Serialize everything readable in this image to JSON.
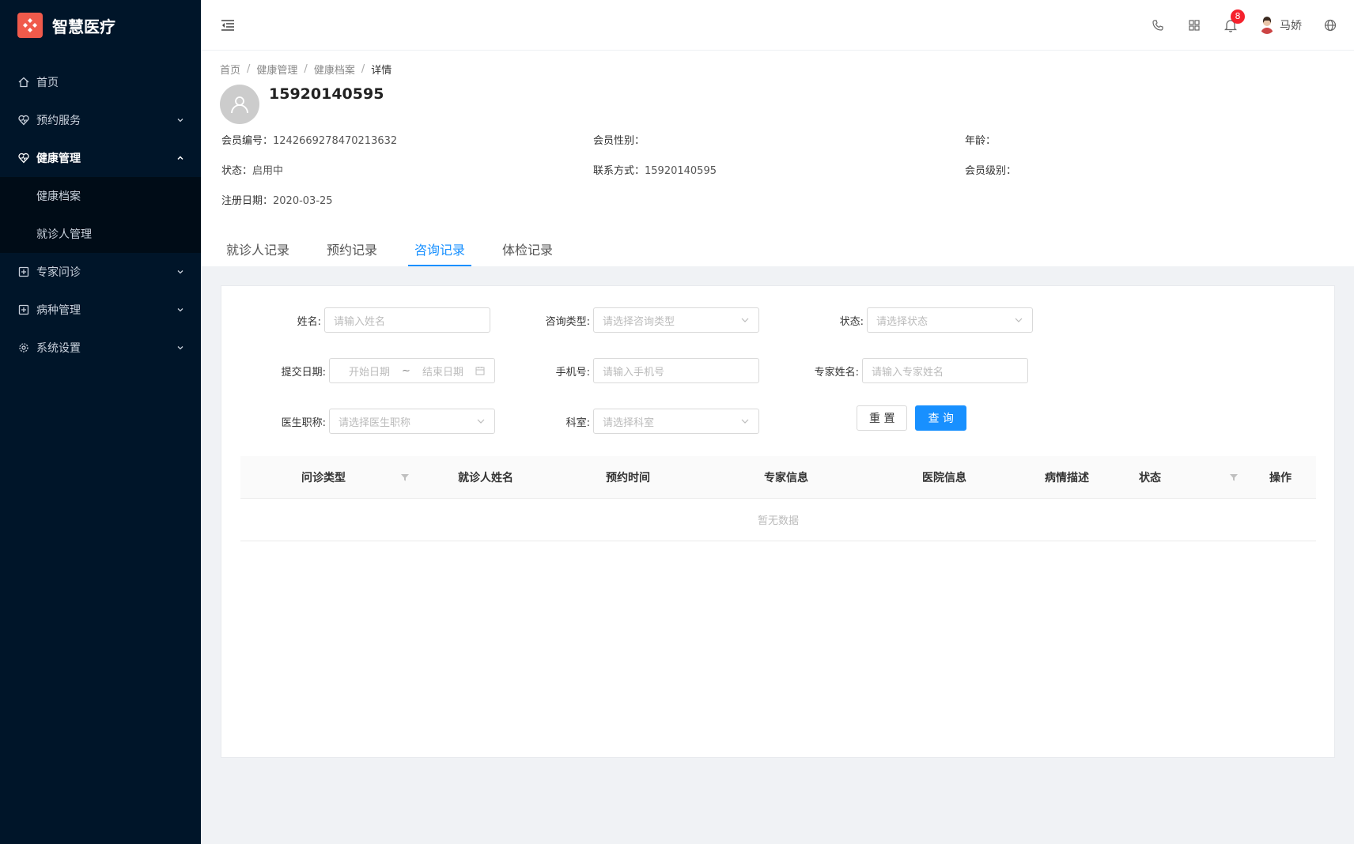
{
  "app": {
    "name": "智慧医疗"
  },
  "sidebar": {
    "items": [
      {
        "label": "首页"
      },
      {
        "label": "预约服务"
      },
      {
        "label": "健康管理"
      },
      {
        "label": "专家问诊"
      },
      {
        "label": "病种管理"
      },
      {
        "label": "系统设置"
      }
    ],
    "submenu": [
      {
        "label": "健康档案"
      },
      {
        "label": "就诊人管理"
      }
    ]
  },
  "header": {
    "notification_count": "8",
    "username": "马娇"
  },
  "breadcrumb": [
    "首页",
    "健康管理",
    "健康档案",
    "详情"
  ],
  "member": {
    "phone_title": "15920140595",
    "fields": {
      "member_no_label": "会员编号：",
      "member_no_value": "1242669278470213632",
      "gender_label": "会员性别：",
      "gender_value": "",
      "age_label": "年龄：",
      "age_value": "",
      "status_label": "状态：",
      "status_value": "启用中",
      "contact_label": "联系方式：",
      "contact_value": "15920140595",
      "level_label": "会员级别：",
      "level_value": "",
      "reg_date_label": "注册日期：",
      "reg_date_value": "2020-03-25"
    }
  },
  "tabs": [
    {
      "label": "就诊人记录",
      "active": false
    },
    {
      "label": "预约记录",
      "active": false
    },
    {
      "label": "咨询记录",
      "active": true
    },
    {
      "label": "体检记录",
      "active": false
    }
  ],
  "filters": {
    "name_label": "姓名:",
    "name_placeholder": "请输入姓名",
    "consult_type_label": "咨询类型:",
    "consult_type_placeholder": "请选择咨询类型",
    "status_label": "状态:",
    "status_placeholder": "请选择状态",
    "submit_date_label": "提交日期:",
    "start_date_placeholder": "开始日期",
    "range_sep": "~",
    "end_date_placeholder": "结束日期",
    "phone_label": "手机号:",
    "phone_placeholder": "请输入手机号",
    "expert_name_label": "专家姓名:",
    "expert_name_placeholder": "请输入专家姓名",
    "doctor_title_label": "医生职称:",
    "doctor_title_placeholder": "请选择医生职称",
    "department_label": "科室:",
    "department_placeholder": "请选择科室",
    "reset_label": "重 置",
    "query_label": "查 询"
  },
  "table": {
    "columns": [
      "问诊类型",
      "就诊人姓名",
      "预约时间",
      "专家信息",
      "医院信息",
      "病情描述",
      "状态",
      "操作"
    ],
    "empty_text": "暂无数据"
  },
  "colors": {
    "sidebar_bg": "#001529",
    "primary": "#1890ff",
    "logo": "#f05a4b",
    "badge": "#f5222d"
  }
}
